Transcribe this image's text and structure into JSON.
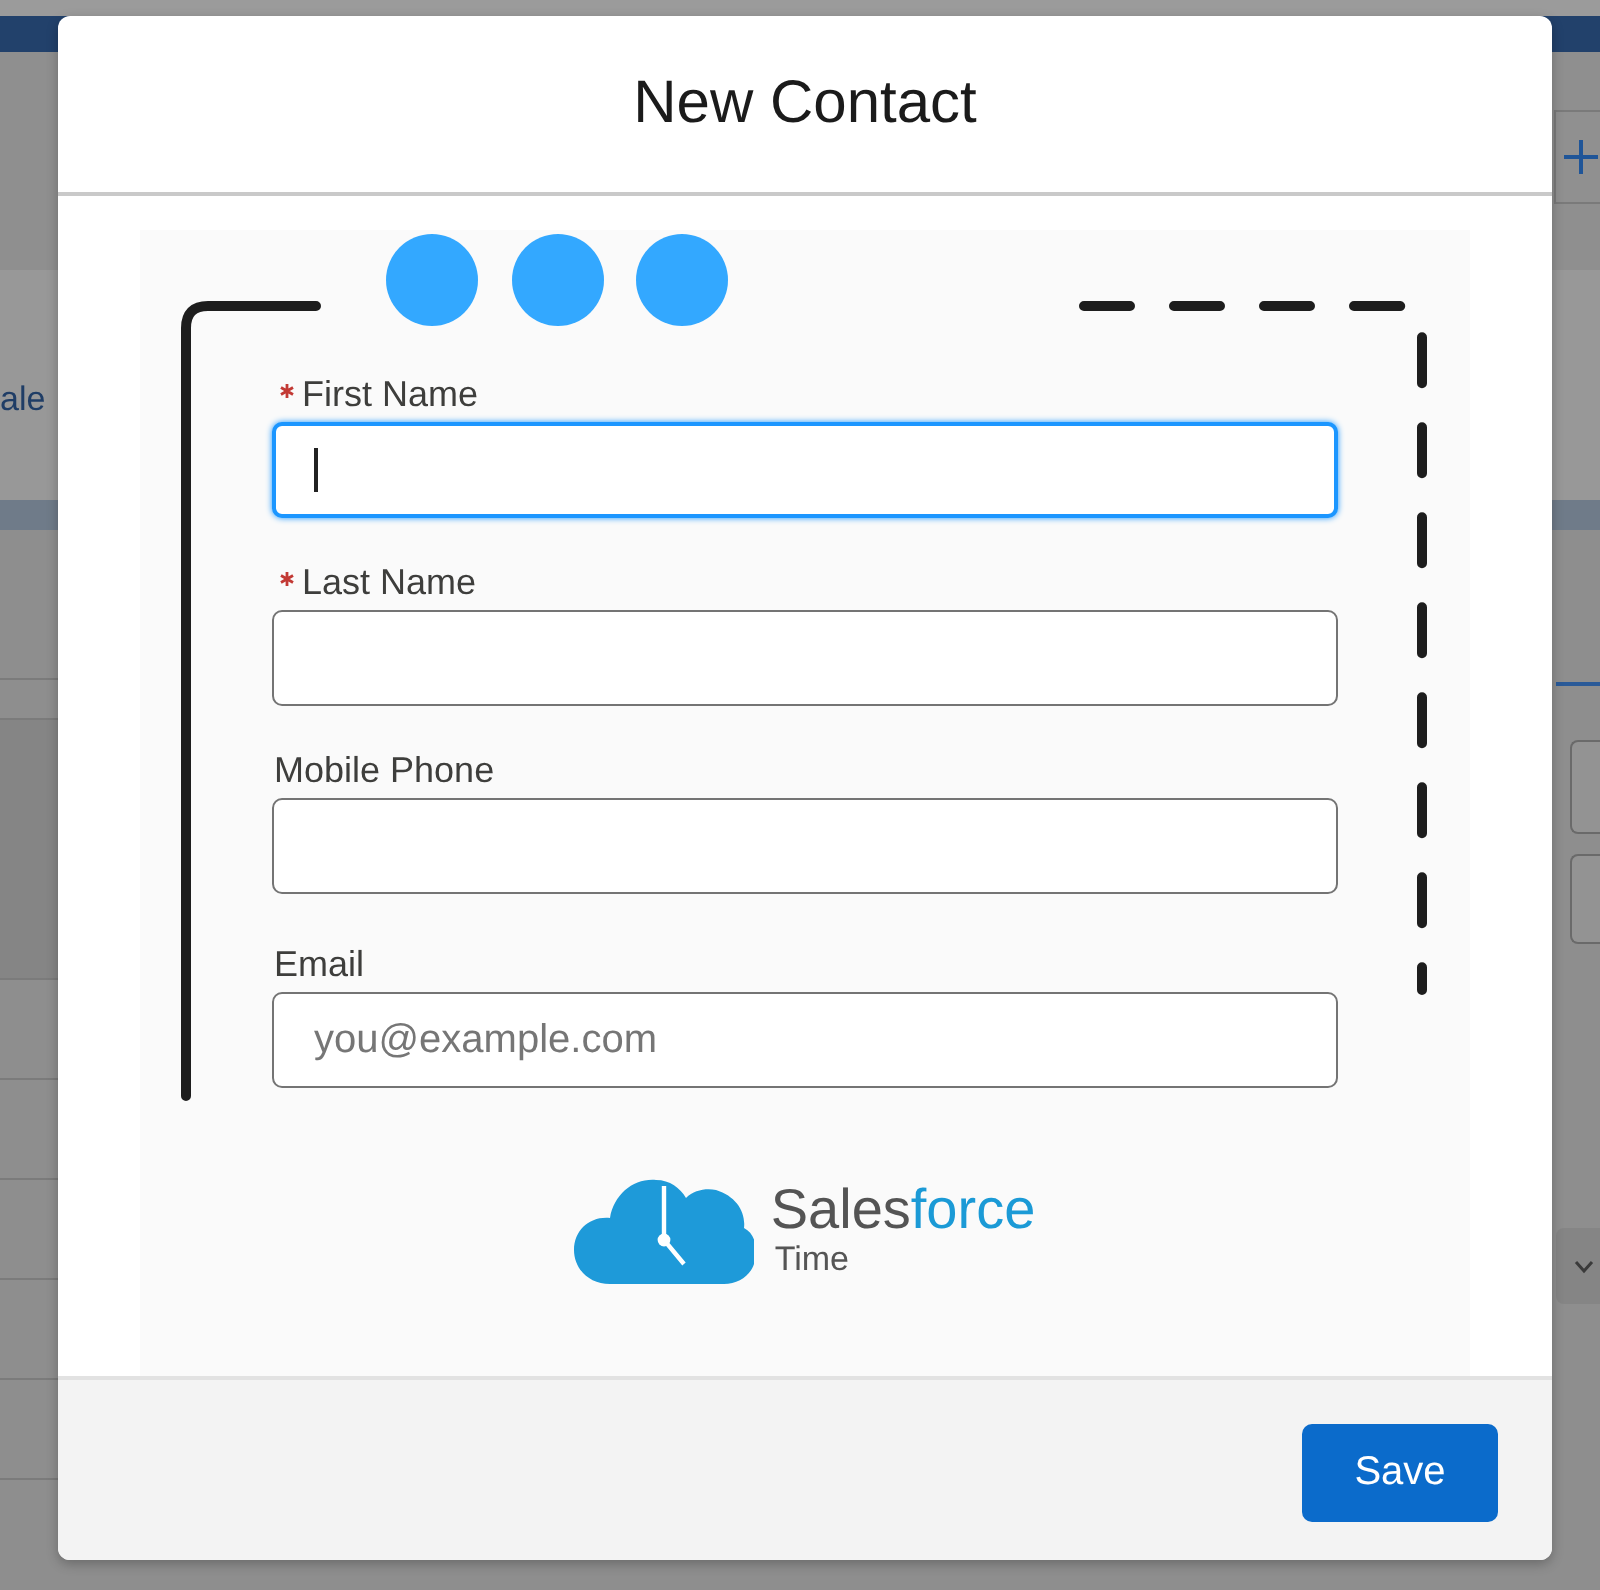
{
  "background": {
    "nav_text": "ale"
  },
  "modal": {
    "title": "New Contact"
  },
  "form": {
    "fields": [
      {
        "label": "First Name",
        "required": true,
        "focused": true
      },
      {
        "label": "Last Name",
        "required": true,
        "focused": false
      },
      {
        "label": "Mobile Phone",
        "required": false,
        "focused": false
      },
      {
        "label": "Email",
        "required": false,
        "focused": false,
        "placeholder": "you@example.com"
      }
    ]
  },
  "logo": {
    "wordmark": "Sales",
    "wordmark_accent": "force",
    "subtitle": "Time"
  },
  "footer": {
    "buttons": [
      "Save"
    ]
  }
}
